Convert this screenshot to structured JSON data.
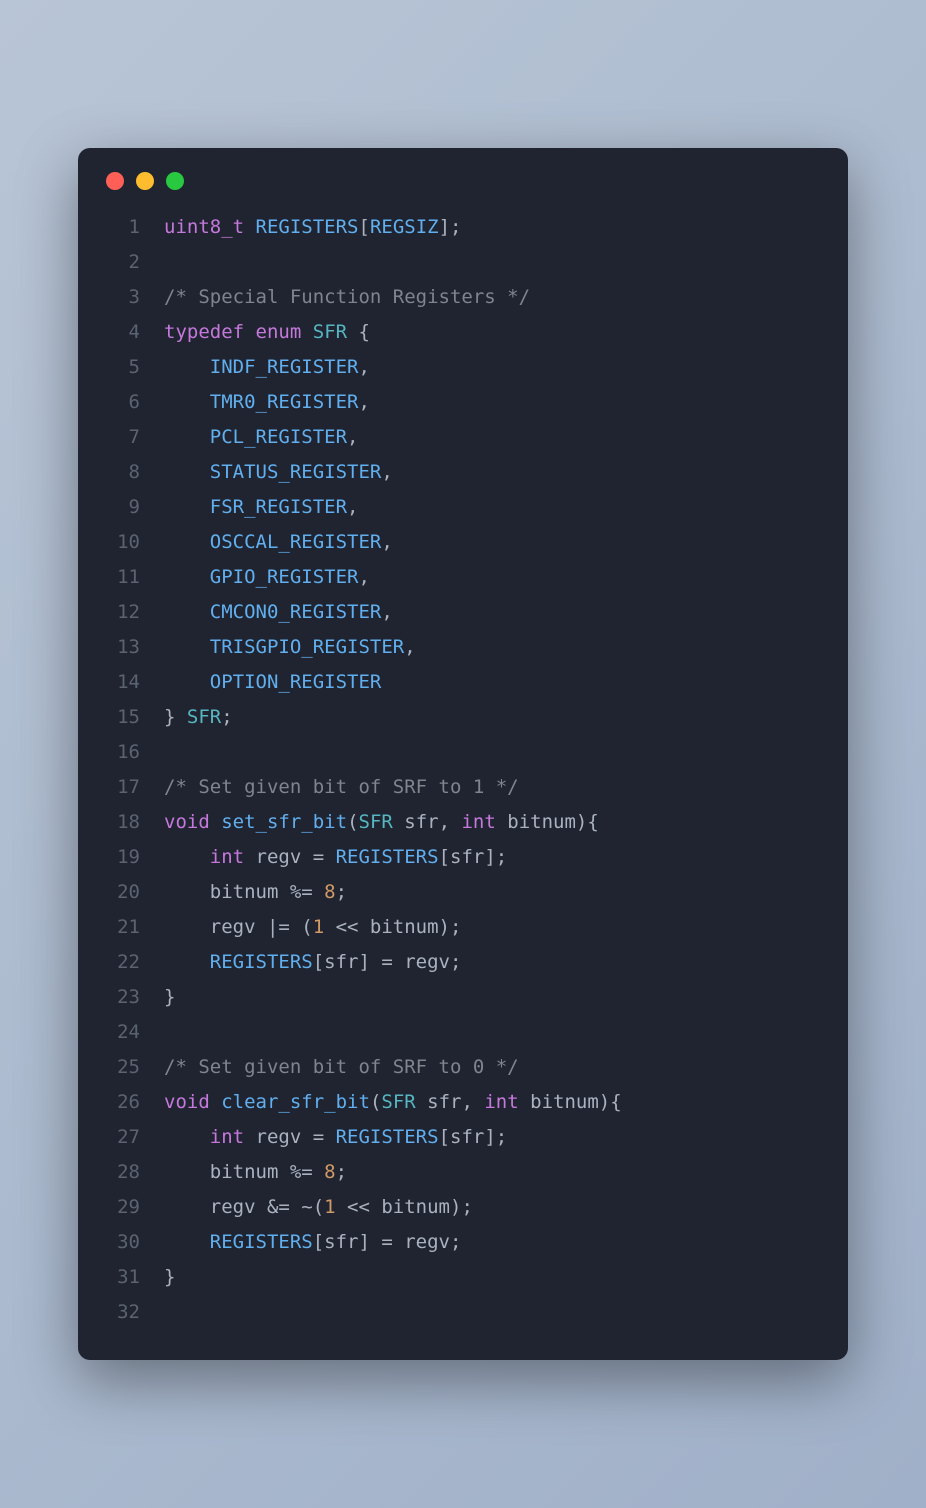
{
  "window": {
    "dots": [
      "red",
      "yellow",
      "green"
    ]
  },
  "code": {
    "lines": [
      [
        {
          "c": "type",
          "t": "uint8_t"
        },
        {
          "c": "punct",
          "t": " "
        },
        {
          "c": "ident",
          "t": "REGISTERS"
        },
        {
          "c": "punct",
          "t": "["
        },
        {
          "c": "ident",
          "t": "REGSIZ"
        },
        {
          "c": "punct",
          "t": "];"
        }
      ],
      [],
      [
        {
          "c": "comment",
          "t": "/* Special Function Registers */"
        }
      ],
      [
        {
          "c": "kw",
          "t": "typedef"
        },
        {
          "c": "punct",
          "t": " "
        },
        {
          "c": "kw",
          "t": "enum"
        },
        {
          "c": "punct",
          "t": " "
        },
        {
          "c": "typename",
          "t": "SFR"
        },
        {
          "c": "punct",
          "t": " {"
        }
      ],
      [
        {
          "c": "punct",
          "t": "    "
        },
        {
          "c": "enumv",
          "t": "INDF_REGISTER"
        },
        {
          "c": "punct",
          "t": ","
        }
      ],
      [
        {
          "c": "punct",
          "t": "    "
        },
        {
          "c": "enumv",
          "t": "TMR0_REGISTER"
        },
        {
          "c": "punct",
          "t": ","
        }
      ],
      [
        {
          "c": "punct",
          "t": "    "
        },
        {
          "c": "enumv",
          "t": "PCL_REGISTER"
        },
        {
          "c": "punct",
          "t": ","
        }
      ],
      [
        {
          "c": "punct",
          "t": "    "
        },
        {
          "c": "enumv",
          "t": "STATUS_REGISTER"
        },
        {
          "c": "punct",
          "t": ","
        }
      ],
      [
        {
          "c": "punct",
          "t": "    "
        },
        {
          "c": "enumv",
          "t": "FSR_REGISTER"
        },
        {
          "c": "punct",
          "t": ","
        }
      ],
      [
        {
          "c": "punct",
          "t": "    "
        },
        {
          "c": "enumv",
          "t": "OSCCAL_REGISTER"
        },
        {
          "c": "punct",
          "t": ","
        }
      ],
      [
        {
          "c": "punct",
          "t": "    "
        },
        {
          "c": "enumv",
          "t": "GPIO_REGISTER"
        },
        {
          "c": "punct",
          "t": ","
        }
      ],
      [
        {
          "c": "punct",
          "t": "    "
        },
        {
          "c": "enumv",
          "t": "CMCON0_REGISTER"
        },
        {
          "c": "punct",
          "t": ","
        }
      ],
      [
        {
          "c": "punct",
          "t": "    "
        },
        {
          "c": "enumv",
          "t": "TRISGPIO_REGISTER"
        },
        {
          "c": "punct",
          "t": ","
        }
      ],
      [
        {
          "c": "punct",
          "t": "    "
        },
        {
          "c": "enumv",
          "t": "OPTION_REGISTER"
        }
      ],
      [
        {
          "c": "punct",
          "t": "} "
        },
        {
          "c": "typename",
          "t": "SFR"
        },
        {
          "c": "punct",
          "t": ";"
        }
      ],
      [],
      [
        {
          "c": "comment",
          "t": "/* Set given bit of SRF to 1 */"
        }
      ],
      [
        {
          "c": "kw",
          "t": "void"
        },
        {
          "c": "punct",
          "t": " "
        },
        {
          "c": "fn",
          "t": "set_sfr_bit"
        },
        {
          "c": "punct",
          "t": "("
        },
        {
          "c": "typename",
          "t": "SFR"
        },
        {
          "c": "punct",
          "t": " sfr, "
        },
        {
          "c": "kw",
          "t": "int"
        },
        {
          "c": "punct",
          "t": " bitnum){"
        }
      ],
      [
        {
          "c": "punct",
          "t": "    "
        },
        {
          "c": "kw",
          "t": "int"
        },
        {
          "c": "punct",
          "t": " regv = "
        },
        {
          "c": "ident",
          "t": "REGISTERS"
        },
        {
          "c": "punct",
          "t": "[sfr];"
        }
      ],
      [
        {
          "c": "punct",
          "t": "    bitnum %= "
        },
        {
          "c": "num",
          "t": "8"
        },
        {
          "c": "punct",
          "t": ";"
        }
      ],
      [
        {
          "c": "punct",
          "t": "    regv |= ("
        },
        {
          "c": "num",
          "t": "1"
        },
        {
          "c": "punct",
          "t": " << bitnum);"
        }
      ],
      [
        {
          "c": "punct",
          "t": "    "
        },
        {
          "c": "ident",
          "t": "REGISTERS"
        },
        {
          "c": "punct",
          "t": "[sfr] = regv;"
        }
      ],
      [
        {
          "c": "punct",
          "t": "}"
        }
      ],
      [],
      [
        {
          "c": "comment",
          "t": "/* Set given bit of SRF to 0 */"
        }
      ],
      [
        {
          "c": "kw",
          "t": "void"
        },
        {
          "c": "punct",
          "t": " "
        },
        {
          "c": "fn",
          "t": "clear_sfr_bit"
        },
        {
          "c": "punct",
          "t": "("
        },
        {
          "c": "typename",
          "t": "SFR"
        },
        {
          "c": "punct",
          "t": " sfr, "
        },
        {
          "c": "kw",
          "t": "int"
        },
        {
          "c": "punct",
          "t": " bitnum){"
        }
      ],
      [
        {
          "c": "punct",
          "t": "    "
        },
        {
          "c": "kw",
          "t": "int"
        },
        {
          "c": "punct",
          "t": " regv = "
        },
        {
          "c": "ident",
          "t": "REGISTERS"
        },
        {
          "c": "punct",
          "t": "[sfr];"
        }
      ],
      [
        {
          "c": "punct",
          "t": "    bitnum %= "
        },
        {
          "c": "num",
          "t": "8"
        },
        {
          "c": "punct",
          "t": ";"
        }
      ],
      [
        {
          "c": "punct",
          "t": "    regv &= ~("
        },
        {
          "c": "num",
          "t": "1"
        },
        {
          "c": "punct",
          "t": " << bitnum);"
        }
      ],
      [
        {
          "c": "punct",
          "t": "    "
        },
        {
          "c": "ident",
          "t": "REGISTERS"
        },
        {
          "c": "punct",
          "t": "[sfr] = regv;"
        }
      ],
      [
        {
          "c": "punct",
          "t": "}"
        }
      ],
      []
    ]
  }
}
